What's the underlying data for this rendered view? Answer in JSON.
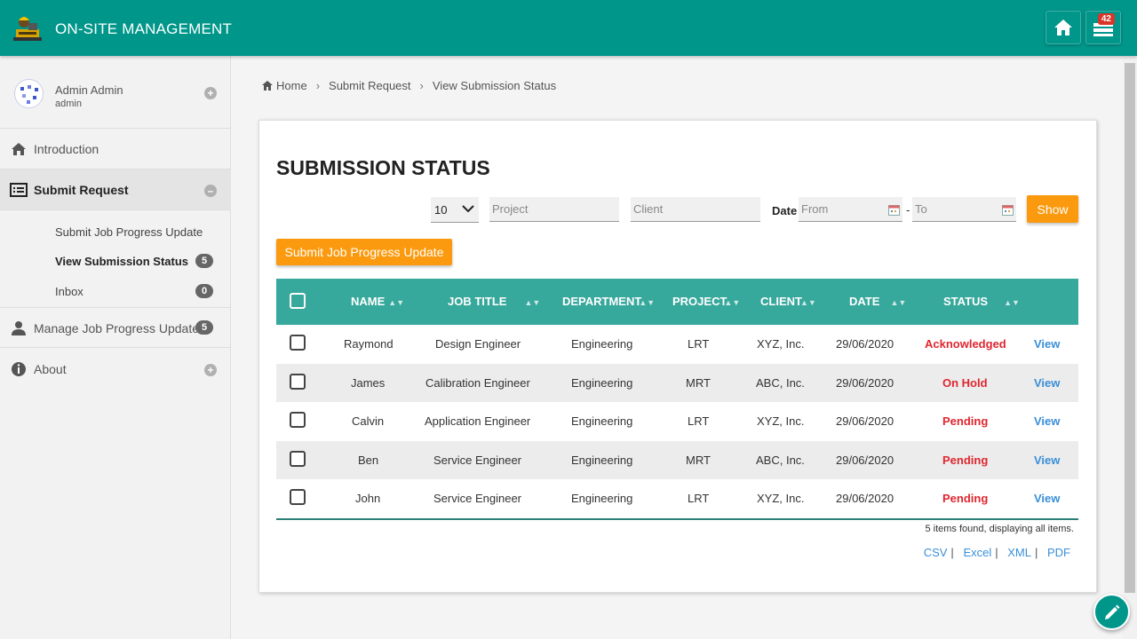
{
  "app": {
    "title": "ON-SITE MANAGEMENT",
    "notification_count": "42"
  },
  "icons": {
    "logo": "construction-worker-logo",
    "home": "home-icon",
    "notifications": "inbox-stack-icon",
    "fab": "pencil-icon"
  },
  "colors": {
    "primary": "#00968a",
    "accent": "#fb9a0e",
    "table_header": "#37a89c",
    "status": "#e0262f",
    "link": "#3a8fd8"
  },
  "user": {
    "name": "Admin Admin",
    "role": "admin"
  },
  "sidebar": {
    "items": [
      {
        "label": "Introduction",
        "icon": "home-icon"
      },
      {
        "label": "Submit Request",
        "icon": "list-icon"
      },
      {
        "label": "Manage Job Progress Update",
        "icon": "user-icon",
        "count": "5"
      },
      {
        "label": "About",
        "icon": "info-icon"
      }
    ],
    "subitems": [
      {
        "label": "Submit Job Progress Update"
      },
      {
        "label": "View Submission Status",
        "count": "5"
      },
      {
        "label": "Inbox",
        "count": "0"
      }
    ]
  },
  "breadcrumb": {
    "home": "Home",
    "level1": "Submit Request",
    "level2": "View Submission Status"
  },
  "page": {
    "title": "SUBMISSION STATUS",
    "filters": {
      "page_size": "10",
      "project_placeholder": "Project",
      "client_placeholder": "Client",
      "date_label": "Date",
      "from_placeholder": "From",
      "to_placeholder": "To",
      "dash": "-",
      "show_label": "Show"
    },
    "submit_button": "Submit Job Progress Update"
  },
  "table": {
    "columns": [
      "NAME",
      "JOB TITLE",
      "DEPARTMENT",
      "PROJECT",
      "CLIENT",
      "DATE",
      "STATUS"
    ],
    "rows": [
      {
        "name": "Raymond",
        "job_title": "Design Engineer",
        "department": "Engineering",
        "project": "LRT",
        "client": "XYZ, Inc.",
        "date": "29/06/2020",
        "status": "Acknowledged",
        "action": "View"
      },
      {
        "name": "James",
        "job_title": "Calibration Engineer",
        "department": "Engineering",
        "project": "MRT",
        "client": "ABC, Inc.",
        "date": "29/06/2020",
        "status": "On Hold",
        "action": "View"
      },
      {
        "name": "Calvin",
        "job_title": "Application Engineer",
        "department": "Engineering",
        "project": "LRT",
        "client": "XYZ, Inc.",
        "date": "29/06/2020",
        "status": "Pending",
        "action": "View"
      },
      {
        "name": "Ben",
        "job_title": "Service Engineer",
        "department": "Engineering",
        "project": "MRT",
        "client": "ABC, Inc.",
        "date": "29/06/2020",
        "status": "Pending",
        "action": "View"
      },
      {
        "name": "John",
        "job_title": "Service Engineer",
        "department": "Engineering",
        "project": "LRT",
        "client": "XYZ, Inc.",
        "date": "29/06/2020",
        "status": "Pending",
        "action": "View"
      }
    ],
    "items_found": "5 items found, displaying all items."
  },
  "exports": {
    "csv": "CSV",
    "excel": "Excel",
    "xml": "XML",
    "pdf": "PDF",
    "separator": "|"
  }
}
